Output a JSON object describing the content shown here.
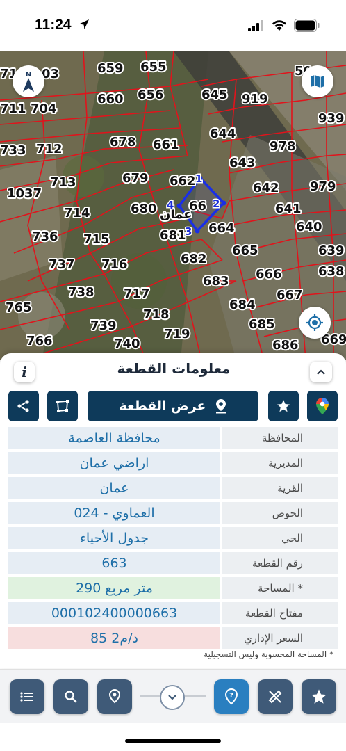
{
  "status_bar": {
    "time": "11:24"
  },
  "map": {
    "parcels": [
      {
        "label": "659"
      },
      {
        "label": "655"
      },
      {
        "label": "660"
      },
      {
        "label": "656"
      },
      {
        "label": "645"
      },
      {
        "label": "919"
      },
      {
        "label": "939"
      },
      {
        "label": "704"
      },
      {
        "label": "711"
      },
      {
        "label": "71"
      },
      {
        "label": "03"
      },
      {
        "label": "733"
      },
      {
        "label": "712"
      },
      {
        "label": "678"
      },
      {
        "label": "661"
      },
      {
        "label": "644"
      },
      {
        "label": "978"
      },
      {
        "label": "643"
      },
      {
        "label": "713"
      },
      {
        "label": "679"
      },
      {
        "label": "662"
      },
      {
        "label": "642"
      },
      {
        "label": "979"
      },
      {
        "label": "1037"
      },
      {
        "label": "714"
      },
      {
        "label": "680"
      },
      {
        "label": "66"
      },
      {
        "label": "641"
      },
      {
        "label": "664"
      },
      {
        "label": "640"
      },
      {
        "label": "736"
      },
      {
        "label": "715"
      },
      {
        "label": "681"
      },
      {
        "label": "665"
      },
      {
        "label": "639"
      },
      {
        "label": "737"
      },
      {
        "label": "716"
      },
      {
        "label": "682"
      },
      {
        "label": "666"
      },
      {
        "label": "638"
      },
      {
        "label": "738"
      },
      {
        "label": "717"
      },
      {
        "label": "683"
      },
      {
        "label": "667"
      },
      {
        "label": "765"
      },
      {
        "label": "718"
      },
      {
        "label": "684"
      },
      {
        "label": "739"
      },
      {
        "label": "719"
      },
      {
        "label": "685"
      },
      {
        "label": "766"
      },
      {
        "label": "740"
      },
      {
        "label": "686"
      },
      {
        "label": "669"
      },
      {
        "label": "50"
      }
    ],
    "place_label": "عمان",
    "vertices": [
      "1",
      "2",
      "3",
      "4"
    ],
    "colors": {
      "parcel_lines": "#e0141c",
      "selected_parcel": "#1a2fe6"
    }
  },
  "sheet": {
    "title": "معلومات القطعة",
    "info_icon_text": "i",
    "show_parcel_label": "عرض القطعة",
    "rows": [
      {
        "label": "المحافظة",
        "value": "محافظة العاصمة"
      },
      {
        "label": "المديرية",
        "value": "اراضي عمان"
      },
      {
        "label": "القرية",
        "value": "عمان"
      },
      {
        "label": "الحوض",
        "value": "العماوي - 024"
      },
      {
        "label": "الحي",
        "value": "جدول الأحياء"
      },
      {
        "label": "رقم القطعة",
        "value": "663"
      },
      {
        "label": "المساحة *",
        "value": "290  متر مربع"
      },
      {
        "label": "مفتاح القطعة",
        "value": "000102400000663"
      },
      {
        "label": "السعر الإداري",
        "value": "85 د/م2"
      }
    ],
    "footnote": "* المساحة المحسوبة وليس التسجيلية"
  },
  "colors": {
    "primary": "#0e3a5a",
    "value_text": "#1e6fa8",
    "area_bg": "#e0f2df",
    "price_bg": "#f7dede",
    "toolbar_active": "#2a7fc0"
  }
}
